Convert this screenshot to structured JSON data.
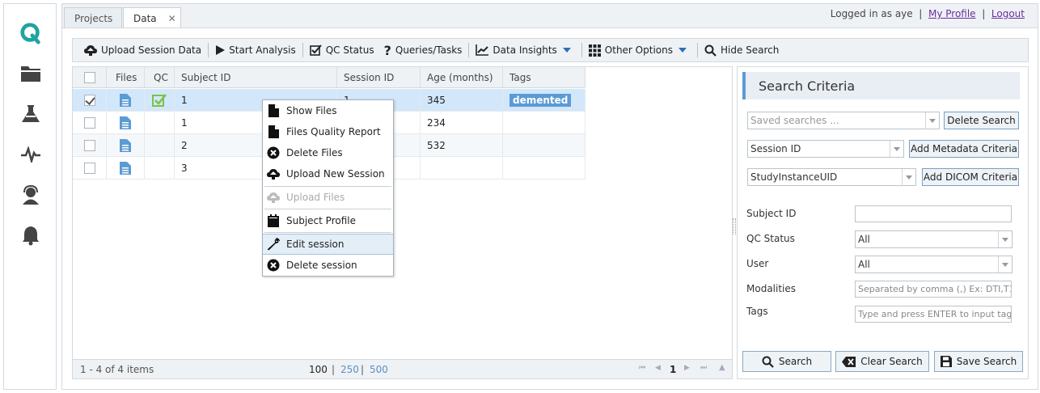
{
  "nav": {
    "icons": [
      "q-logo-icon",
      "folder-icon",
      "flask-icon",
      "pulse-icon",
      "support-agent-icon",
      "bell-icon"
    ]
  },
  "tabs": [
    {
      "label": "Projects",
      "active": false
    },
    {
      "label": "Data",
      "active": true,
      "close": "✕"
    }
  ],
  "user": {
    "logged_in_label": "Logged in as",
    "username": "aye",
    "profile_link": "My Profile",
    "logout_link": "Logout",
    "sep": "|"
  },
  "toolbar": {
    "upload": "Upload Session Data",
    "start_analysis": "Start Analysis",
    "qc_status": "QC Status",
    "queries": "Queries/Tasks",
    "data_insights": "Data Insights",
    "other_options": "Other Options",
    "hide_search": "Hide Search"
  },
  "grid": {
    "columns": [
      "Files",
      "QC",
      "Subject ID",
      "Session ID",
      "Age (months)",
      "Tags"
    ],
    "rows": [
      {
        "selected": true,
        "qc": true,
        "subject_id": "1",
        "session_id": "1",
        "age": "345",
        "tag": "demented"
      },
      {
        "selected": false,
        "qc": false,
        "subject_id": "1",
        "session_id": "",
        "age": "234",
        "tag": ""
      },
      {
        "selected": false,
        "qc": false,
        "subject_id": "2",
        "session_id": "",
        "age": "532",
        "tag": ""
      },
      {
        "selected": false,
        "qc": false,
        "subject_id": "3",
        "session_id": "",
        "age": "",
        "tag": ""
      }
    ],
    "footer": {
      "summary": "1 - 4 of 4 items",
      "sizes": [
        "100",
        "250",
        "500"
      ],
      "sep": "|",
      "page": "1"
    }
  },
  "context_menu": {
    "items": [
      {
        "label": "Show Files",
        "icon": "file-icon",
        "disabled": false
      },
      {
        "label": "Files Quality Report",
        "icon": "file-icon",
        "disabled": false
      },
      {
        "label": "Delete Files",
        "icon": "close-circle-icon",
        "disabled": false
      },
      {
        "label": "Upload New Session",
        "icon": "cloud-upload-icon",
        "disabled": false
      },
      {
        "label": "Upload Files",
        "icon": "cloud-upload-icon",
        "disabled": true
      },
      {
        "label": "Subject Profile",
        "icon": "clipboard-icon",
        "disabled": false
      },
      {
        "label": "Edit session",
        "icon": "wrench-icon",
        "disabled": false,
        "hover": true
      },
      {
        "label": "Delete session",
        "icon": "close-circle-icon",
        "disabled": false
      }
    ]
  },
  "search": {
    "title": "Search Criteria",
    "saved_placeholder": "Saved searches ...",
    "delete_search": "Delete Search",
    "metadata_value": "Session ID",
    "add_metadata": "Add Metadata Criteria",
    "dicom_value": "StudyInstanceUID",
    "add_dicom": "Add DICOM Criteria",
    "fields": {
      "subject_id_label": "Subject ID",
      "subject_id_value": "",
      "qc_status_label": "QC Status",
      "qc_status_value": "All",
      "user_label": "User",
      "user_value": "All",
      "modalities_label": "Modalities",
      "modalities_placeholder": "Separated by comma (,) Ex: DTI,T1",
      "tags_label": "Tags",
      "tags_placeholder": "Type and press ENTER to input tag"
    },
    "buttons": {
      "search": "Search",
      "clear": "Clear Search",
      "save": "Save Search"
    }
  },
  "colors": {
    "accent": "#5b9bd5",
    "brand": "#1fa3a3",
    "qc_green": "#7bc24a",
    "tag_bg": "#5b9bd5"
  }
}
